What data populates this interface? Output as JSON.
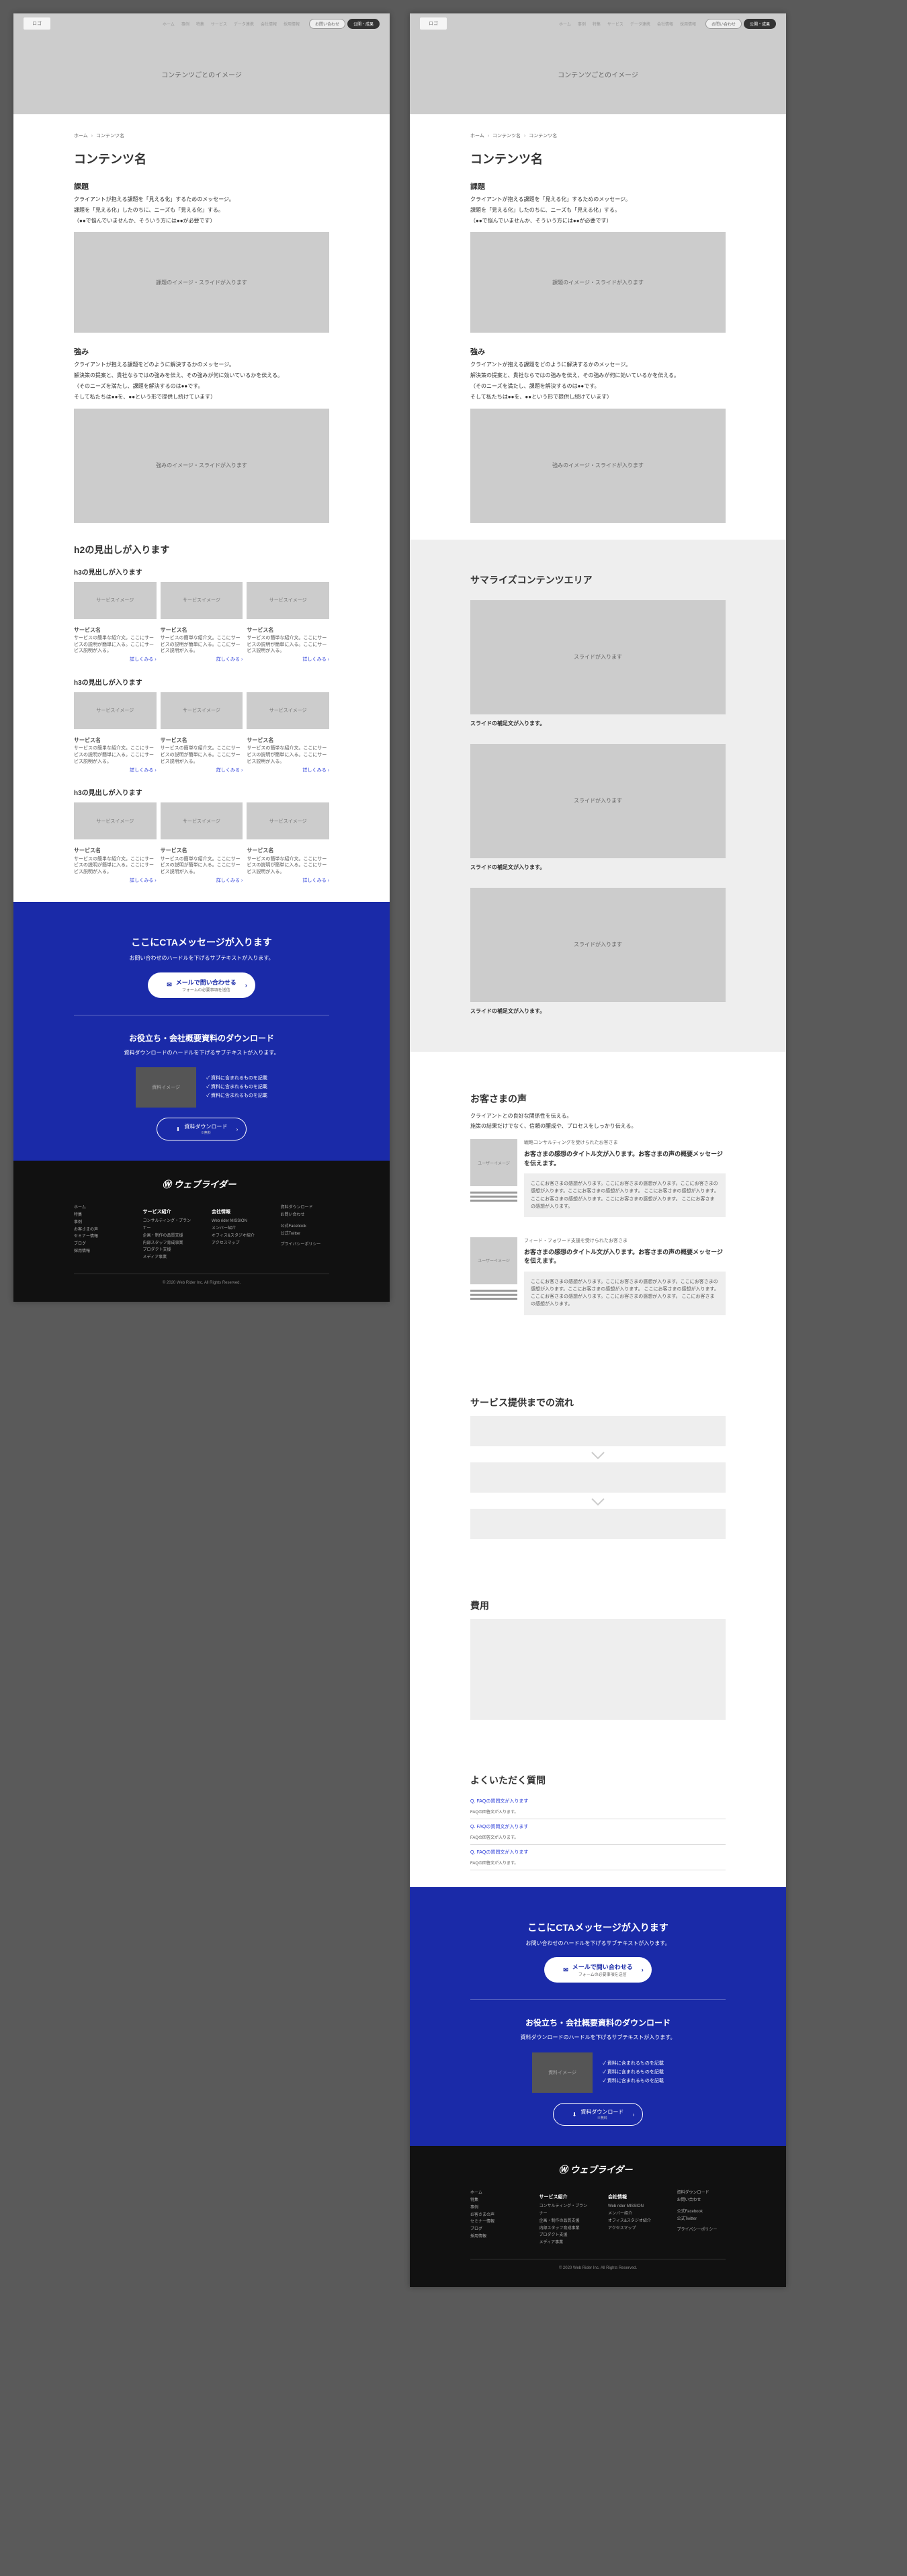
{
  "header": {
    "logo": "ロゴ",
    "nav": [
      "ホーム",
      "事例",
      "特集",
      "サービス",
      "データ連携",
      "会社情報",
      "採用情報"
    ],
    "pill1": "お問い合わせ",
    "pill2": "公開・成果"
  },
  "hero": "コンテンツごとのイメージ",
  "breadcrumb": {
    "home": "ホーム",
    "sep": "›",
    "p1": "コンテンツ名",
    "p2": "コンテンツ名"
  },
  "h1": "コンテンツ名",
  "kadai": {
    "h": "課題",
    "p1": "クライアントが抱える課題を「見える化」するためのメッセージ。",
    "p2": "課題を「見える化」したのちに、ニーズも「見える化」する。",
    "p3": "（●●で悩んでいませんか、そういう方には●●が必要です）",
    "ph": "課題のイメージ・スライドが入ります"
  },
  "tsuyomi": {
    "h": "強み",
    "p1": "クライアントが抱える課題をどのように解決するかのメッセージ。",
    "p2": "解決策の提案と、貴社ならではの強みを伝え、その強みが何に効いているかを伝える。",
    "p3": "（そのニーズを満たし、課題を解決するのは●●です。",
    "p4": "そして私たちは●●を、●●という形で提供し続けています）",
    "ph": "強みのイメージ・スライドが入ります"
  },
  "h2gen": "h2の見出しが入ります",
  "h3gen": "h3の見出しが入ります",
  "card": {
    "img": "サービスイメージ",
    "title": "サービス名",
    "body": "サービスの簡単な紹介文。ここにサービスの説明が簡単に入る。ここにサービス説明が入る。",
    "more": "詳しくみる ›"
  },
  "summary": {
    "h": "サマライズコンテンツエリア",
    "slide": "スライドが入ります",
    "caption": "スライドの補足文が入ります。"
  },
  "voice": {
    "h": "お客さまの声",
    "lead1": "クライアントとの良好な関係性を伝える。",
    "lead2": "施策の結果だけでなく、信頼の醸成や、プロセスをしっかり伝える。",
    "img": "ユーザーイメージ",
    "sub1": "戦略コンサルティングを受けられたお客さま",
    "hd1": "お客さまの感想のタイトル文が入ります。お客さまの声の概要メッセージを伝えます。",
    "sub2": "フィード・フォワード支援を受けられたお客さま",
    "hd2": "お客さまの感想のタイトル文が入ります。お客さまの声の概要メッセージを伝えます。",
    "desc": "ここにお客さまの感想が入ります。ここにお客さまの感想が入ります。ここにお客さまの感想が入ります。ここにお客さまの感想が入ります。\nここにお客さまの感想が入ります。ここにお客さまの感想が入ります。ここにお客さまの感想が入ります。\nここにお客さまの感想が入ります。"
  },
  "flow": {
    "h": "サービス提供までの流れ"
  },
  "cost": {
    "h": "費用"
  },
  "faq": {
    "h": "よくいただく質問",
    "items": [
      {
        "q": "Q. FAQの質問文が入ります",
        "a": "FAQの回答文が入ります。"
      },
      {
        "q": "Q. FAQの質問文が入ります",
        "a": "FAQの回答文が入ります。"
      },
      {
        "q": "Q. FAQの質問文が入ります",
        "a": "FAQの回答文が入ります。"
      }
    ]
  },
  "cta": {
    "h": "ここにCTAメッセージが入ります",
    "sub": "お問い合わせのハードルを下げるサブテキストが入ります。",
    "btn1": "メールで問い合わせる",
    "btn1sub": "フォームの必要事項を送信",
    "h3": "お役立ち・会社概要資料のダウンロード",
    "sub2": "資料ダウンロードのハードルを下げるサブテキストが入ります。",
    "dlimg": "資料イメージ",
    "li": "資料に含まれるものを記載",
    "btn2": "資料ダウンロード",
    "btn2sub": "※無料"
  },
  "footer": {
    "logo": "ウェブライダー",
    "cols": [
      {
        "title": "",
        "links": [
          "ホーム",
          "特集",
          "事例",
          "お客さまの声",
          "セミナー情報",
          "ブログ",
          "採用情報"
        ]
      },
      {
        "title": "サービス紹介",
        "links": [
          "コンサルティング・プランナー",
          "企画・制作の品質支援",
          "内部スタッフ育成事業",
          "プロダクト支援",
          "メディア事業"
        ]
      },
      {
        "title": "会社情報",
        "links": [
          "Web rider MISSION",
          "メンバー紹介",
          "オフィス&スタジオ紹介",
          "アクセスマップ"
        ]
      },
      {
        "title": "",
        "links": [
          "資料ダウンロード",
          "お問い合わせ",
          "公式Facebook",
          "公式Twitter",
          "プライバシーポリシー"
        ]
      }
    ],
    "copy": "© 2020 Web Rider Inc. All Rights Reserved."
  }
}
